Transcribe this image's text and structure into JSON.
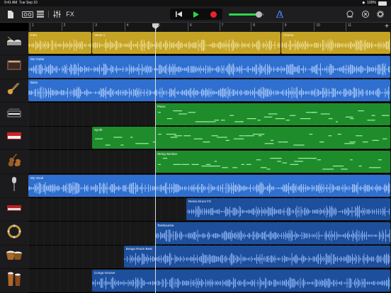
{
  "status": {
    "time": "9:41 AM",
    "date": "Tue Sep 10",
    "battery": "100%"
  },
  "toolbar": {
    "fx_label": "FX"
  },
  "ruler": {
    "bars": [
      "1",
      "2",
      "3",
      "4",
      "5",
      "6",
      "7",
      "8",
      "9",
      "10",
      "11"
    ]
  },
  "colors": {
    "yellow": "#c5a324",
    "blue": "#2f6fcf",
    "green": "#1f8c2c",
    "darkblue": "#1d4f9c"
  },
  "tracks": [
    {
      "instrument": "drums",
      "regions": [
        {
          "name": "Intro",
          "start": 0,
          "end": 90,
          "kind": "audio",
          "color": "yellow"
        },
        {
          "name": "Verse 1",
          "start": 90,
          "end": 357,
          "kind": "audio",
          "color": "yellow"
        },
        {
          "name": "Chorus",
          "start": 357,
          "end": 512,
          "kind": "audio",
          "color": "yellow"
        }
      ]
    },
    {
      "instrument": "guitar-amp",
      "regions": [
        {
          "name": "My Guitar",
          "start": 0,
          "end": 512,
          "kind": "audio",
          "color": "blue"
        }
      ]
    },
    {
      "instrument": "bass",
      "regions": [
        {
          "name": "Bass",
          "start": 0,
          "end": 512,
          "kind": "audio",
          "color": "blue"
        }
      ]
    },
    {
      "instrument": "piano",
      "regions": [
        {
          "name": "Piano",
          "start": 179,
          "end": 512,
          "kind": "midi",
          "color": "green"
        }
      ]
    },
    {
      "instrument": "synth",
      "regions": [
        {
          "name": "Synth",
          "start": 90,
          "end": 512,
          "kind": "midi",
          "color": "green"
        }
      ]
    },
    {
      "instrument": "strings",
      "regions": [
        {
          "name": "String Section",
          "start": 179,
          "end": 512,
          "kind": "midi",
          "color": "green"
        }
      ]
    },
    {
      "instrument": "microphone",
      "regions": [
        {
          "name": "My Vocal",
          "start": 0,
          "end": 512,
          "kind": "audio",
          "color": "blue"
        }
      ]
    },
    {
      "instrument": "keyboard",
      "regions": [
        {
          "name": "Remix Drum FX",
          "start": 223,
          "end": 512,
          "kind": "audio",
          "color": "darkblue"
        }
      ]
    },
    {
      "instrument": "tambourine",
      "regions": [
        {
          "name": "Tambourine",
          "start": 179,
          "end": 512,
          "kind": "audio",
          "color": "darkblue"
        }
      ]
    },
    {
      "instrument": "bongos",
      "regions": [
        {
          "name": "Bongo Room Beat",
          "start": 135,
          "end": 512,
          "kind": "audio",
          "color": "darkblue"
        }
      ]
    },
    {
      "instrument": "congas",
      "regions": [
        {
          "name": "Conga Groove",
          "start": 90,
          "end": 512,
          "kind": "audio",
          "color": "darkblue"
        }
      ]
    }
  ]
}
